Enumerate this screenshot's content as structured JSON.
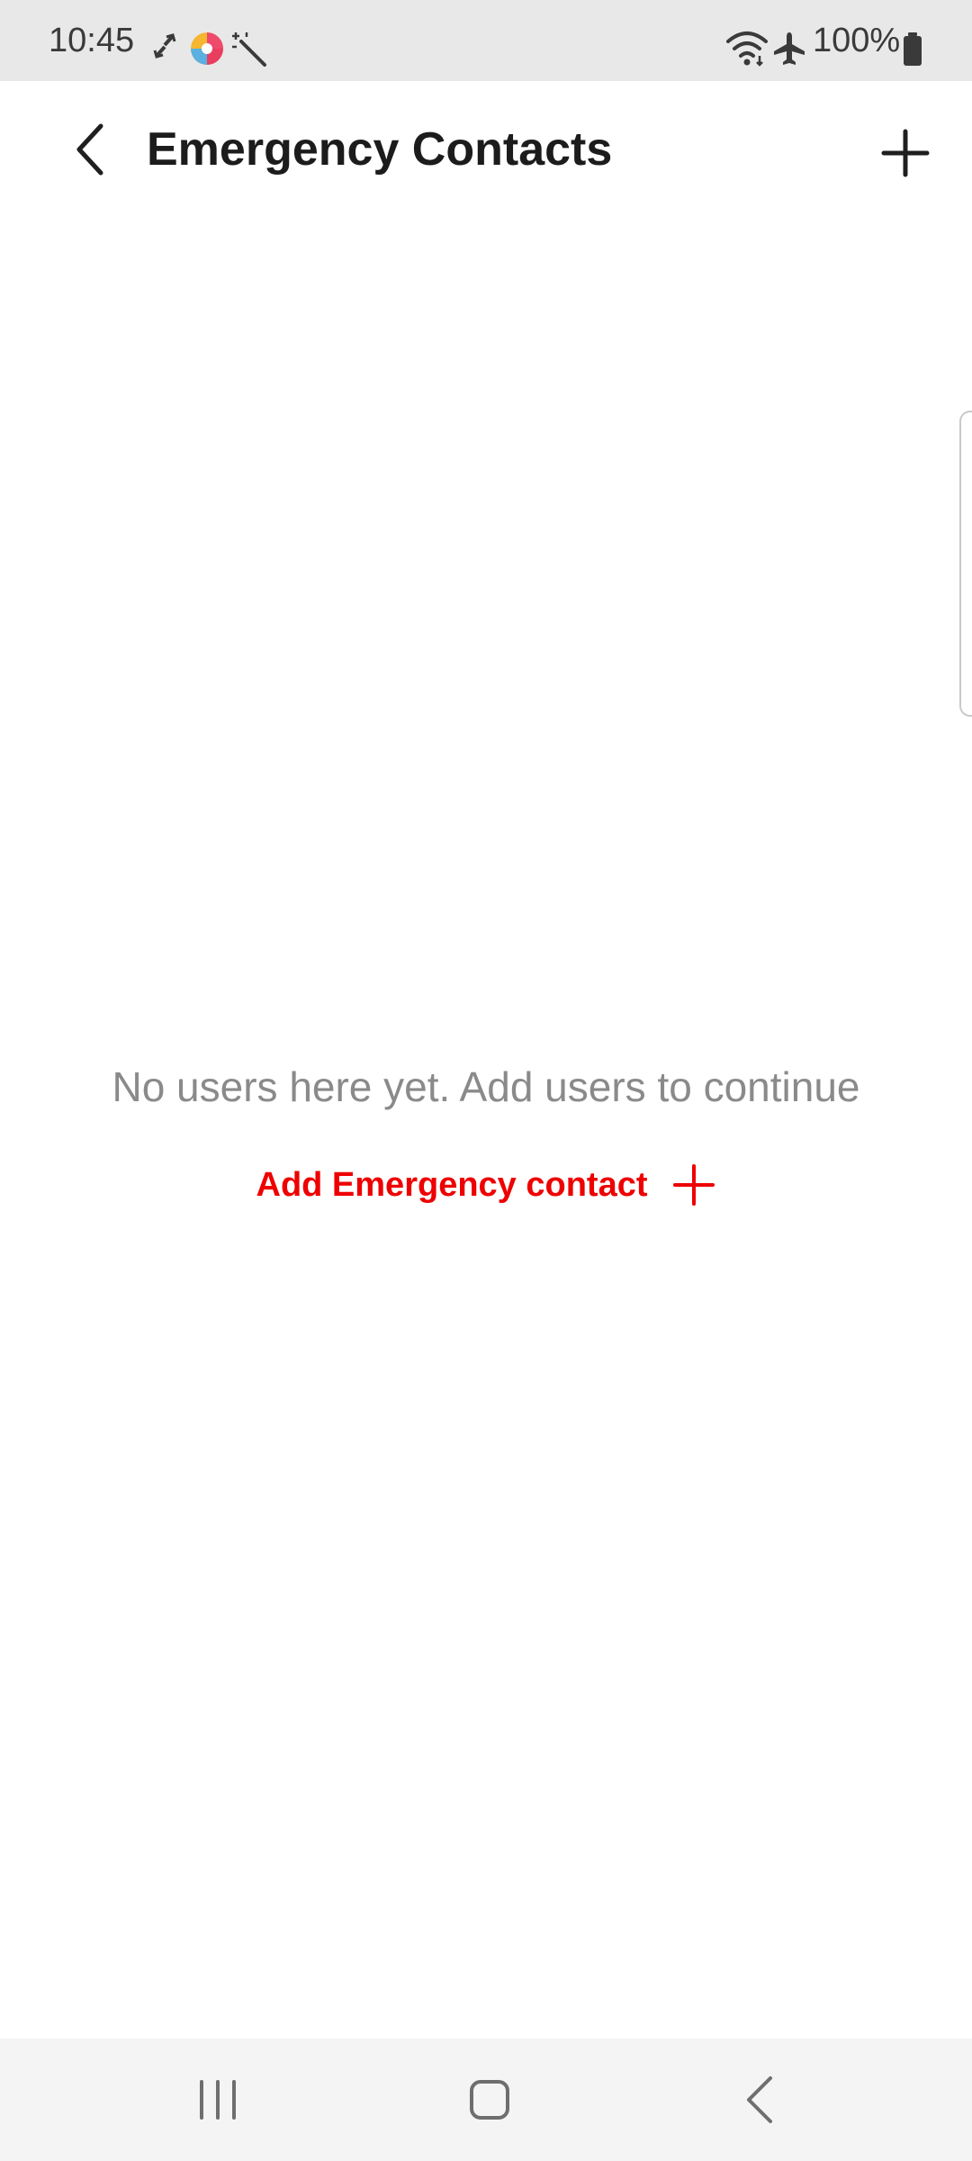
{
  "status_bar": {
    "time": "10:45",
    "battery": "100%",
    "icons": [
      "sync-icon",
      "app-icon",
      "magic-wand-icon",
      "wifi-icon",
      "airplane-mode-icon",
      "battery-icon"
    ]
  },
  "app_bar": {
    "title": "Emergency Contacts",
    "back_icon": "chevron-left-icon",
    "add_icon": "plus-icon"
  },
  "empty_state": {
    "message": "No users here yet. Add users to continue",
    "add_label": "Add Emergency contact",
    "accent_color": "#ee0000"
  },
  "nav_bar": {
    "buttons": [
      "recent-apps-icon",
      "home-icon",
      "back-icon"
    ]
  }
}
